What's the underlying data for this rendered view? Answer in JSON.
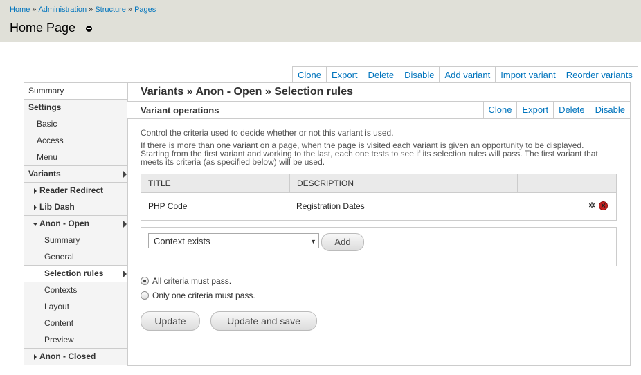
{
  "breadcrumb": {
    "items": [
      "Home",
      "Administration",
      "Structure",
      "Pages"
    ],
    "separator": "»"
  },
  "page": {
    "title": "Home Page"
  },
  "top_operations": [
    "Clone",
    "Export",
    "Delete",
    "Disable",
    "Add variant",
    "Import variant",
    "Reorder variants"
  ],
  "sidebar": {
    "summary": "Summary",
    "settings": "Settings",
    "settings_items": [
      "Basic",
      "Access",
      "Menu"
    ],
    "variants": "Variants",
    "reader_redirect": "Reader Redirect",
    "lib_dash": "Lib Dash",
    "anon_open": "Anon - Open",
    "anon_open_items": [
      "Summary",
      "General",
      "Selection rules",
      "Contexts",
      "Layout",
      "Content",
      "Preview"
    ],
    "anon_closed": "Anon - Closed"
  },
  "main": {
    "title": "Variants » Anon - Open » Selection rules",
    "variant_operations_label": "Variant operations",
    "variant_operations": [
      "Clone",
      "Export",
      "Delete",
      "Disable"
    ],
    "intro_1": "Control the criteria used to decide whether or not this variant is used.",
    "intro_2": "If there is more than one variant on a page, when the page is visited each variant is given an opportunity to be displayed. Starting from the first variant and working to the last, each one tests to see if its selection rules will pass. The first variant that meets its criteria (as specified below) will be used.",
    "table": {
      "headers": [
        "TITLE",
        "DESCRIPTION"
      ],
      "rows": [
        {
          "title": "PHP Code",
          "description": "Registration Dates"
        }
      ]
    },
    "add_select_value": "Context exists",
    "add_button": "Add",
    "radio_all": "All criteria must pass.",
    "radio_one": "Only one criteria must pass.",
    "update_button": "Update",
    "update_save_button": "Update and save"
  }
}
